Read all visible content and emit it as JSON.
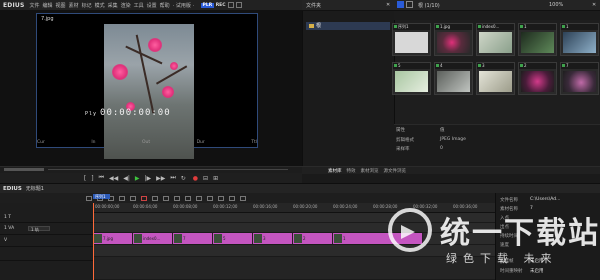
{
  "app": {
    "name": "EDIUS"
  },
  "menu": {
    "items": [
      "文件",
      "编辑",
      "视图",
      "素材",
      "标记",
      "模式",
      "采集",
      "渲染",
      "工具",
      "设置",
      "帮助",
      "· 试用版 ·"
    ],
    "plr": "PLR",
    "rec": "REC"
  },
  "player": {
    "clip_name": "7.jpg",
    "timecode_label": "Ply",
    "timecode": "00:00:00:00",
    "cue": {
      "cur": "Cur",
      "in": "In",
      "out": "Out",
      "dur": "Dur",
      "ttl": "Ttl"
    }
  },
  "bin": {
    "title": "文件夹",
    "root_folder": "根",
    "path": "根 (1/10)",
    "zoom": "100%"
  },
  "assets": {
    "thumbs": [
      {
        "label": "序列1",
        "color": "#d8d8d8"
      },
      {
        "label": "1.jpg",
        "color": "#b83b7a"
      },
      {
        "label": "index0...",
        "color": "#cfd6c8"
      },
      {
        "label": "1",
        "color": "#3b5f3a"
      },
      {
        "label": "1",
        "color": "#5f7d97"
      },
      {
        "label": "5",
        "color": "#a8c6a1"
      },
      {
        "label": "4",
        "color": "#8b8f8c"
      },
      {
        "label": "3",
        "color": "#b9b9a8"
      },
      {
        "label": "2",
        "color": "#8a2d6d"
      },
      {
        "label": "7",
        "color": "#6d4a6a"
      }
    ],
    "props": [
      {
        "k": "属性",
        "v": "值"
      },
      {
        "k": "剪辑格式",
        "v": "JPEG Image"
      },
      {
        "k": "采样率",
        "v": "0"
      }
    ]
  },
  "tabs": [
    "素材库",
    "特效",
    "素材浏览",
    "源文件浏览"
  ],
  "timeline": {
    "seq_name": "无标题1",
    "seq_tab": "序列1",
    "ruler": [
      "00:00:00;00",
      "00:00:04;00",
      "00:00:08;00",
      "00:00:12;00",
      "00:00:16;00",
      "00:00:20;00",
      "00:00:24;00",
      "00:00:28;00",
      "00:00:32;00",
      "00:00:36;00"
    ],
    "tracks": [
      {
        "name": "1 T",
        "box": ""
      },
      {
        "name": "1 VA",
        "box": "1 轨"
      },
      {
        "name": "V",
        "box": ""
      },
      {
        "name": "",
        "box": ""
      }
    ],
    "clips": [
      "7.jpg",
      "index0...",
      "7",
      "5",
      "3",
      "2",
      "1"
    ]
  },
  "info_panel": [
    {
      "k": "文件名称",
      "v": "C:\\Users\\Ad..."
    },
    {
      "k": "素材名称",
      "v": "7"
    },
    {
      "k": "入点",
      "v": ""
    },
    {
      "k": "出点",
      "v": ""
    },
    {
      "k": "持续时间",
      "v": ""
    },
    {
      "k": "速度",
      "v": ""
    },
    {
      "k": "冻结帧",
      "v": "未启用"
    },
    {
      "k": "时间重映射",
      "v": "未启用"
    }
  ],
  "watermark": {
    "main": "统一下载站",
    "sub": "绿色下载 未来"
  }
}
